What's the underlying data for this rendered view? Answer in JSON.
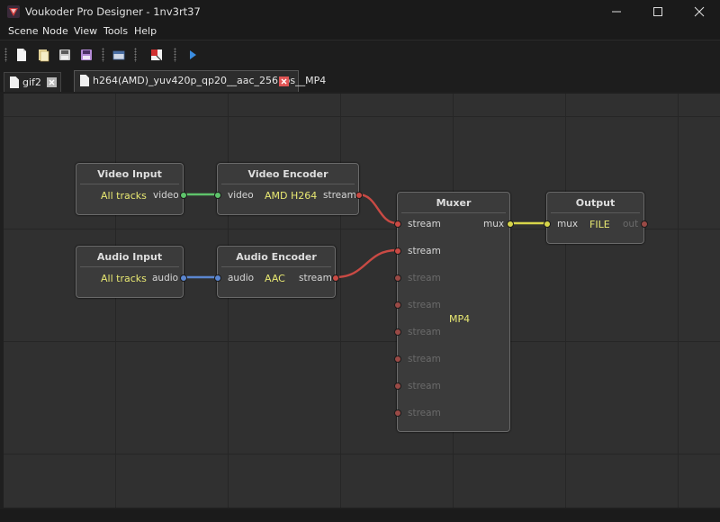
{
  "window": {
    "title": "Voukoder Pro Designer - 1nv3rt37"
  },
  "menu": [
    "Scene",
    "Node",
    "View",
    "Tools",
    "Help"
  ],
  "tabs": [
    {
      "label": "gif2",
      "active": false
    },
    {
      "label": "h264(AMD)_yuv420p_qp20__aac_256kbs__MP4",
      "active": true
    }
  ],
  "nodes": {
    "video_input": {
      "title": "Video Input",
      "value": "All tracks",
      "out_port": "video"
    },
    "video_encoder": {
      "title": "Video Encoder",
      "in_port": "video",
      "value": "AMD H264",
      "out_port": "stream"
    },
    "audio_input": {
      "title": "Audio Input",
      "value": "All tracks",
      "out_port": "audio"
    },
    "audio_encoder": {
      "title": "Audio Encoder",
      "in_port": "audio",
      "value": "AAC",
      "out_port": "stream"
    },
    "muxer": {
      "title": "Muxer",
      "value": "MP4",
      "out_port": "mux",
      "in_ports": [
        "stream",
        "stream",
        "stream",
        "stream",
        "stream",
        "stream",
        "stream",
        "stream"
      ]
    },
    "output": {
      "title": "Output",
      "in_port": "mux",
      "value": "FILE",
      "out_port": "out"
    }
  },
  "colors": {
    "video_link": "#5ec36b",
    "audio_link": "#5b86d0",
    "stream_link": "#c94a44",
    "mux_link": "#d6d44a",
    "value_text": "#e8e872"
  }
}
